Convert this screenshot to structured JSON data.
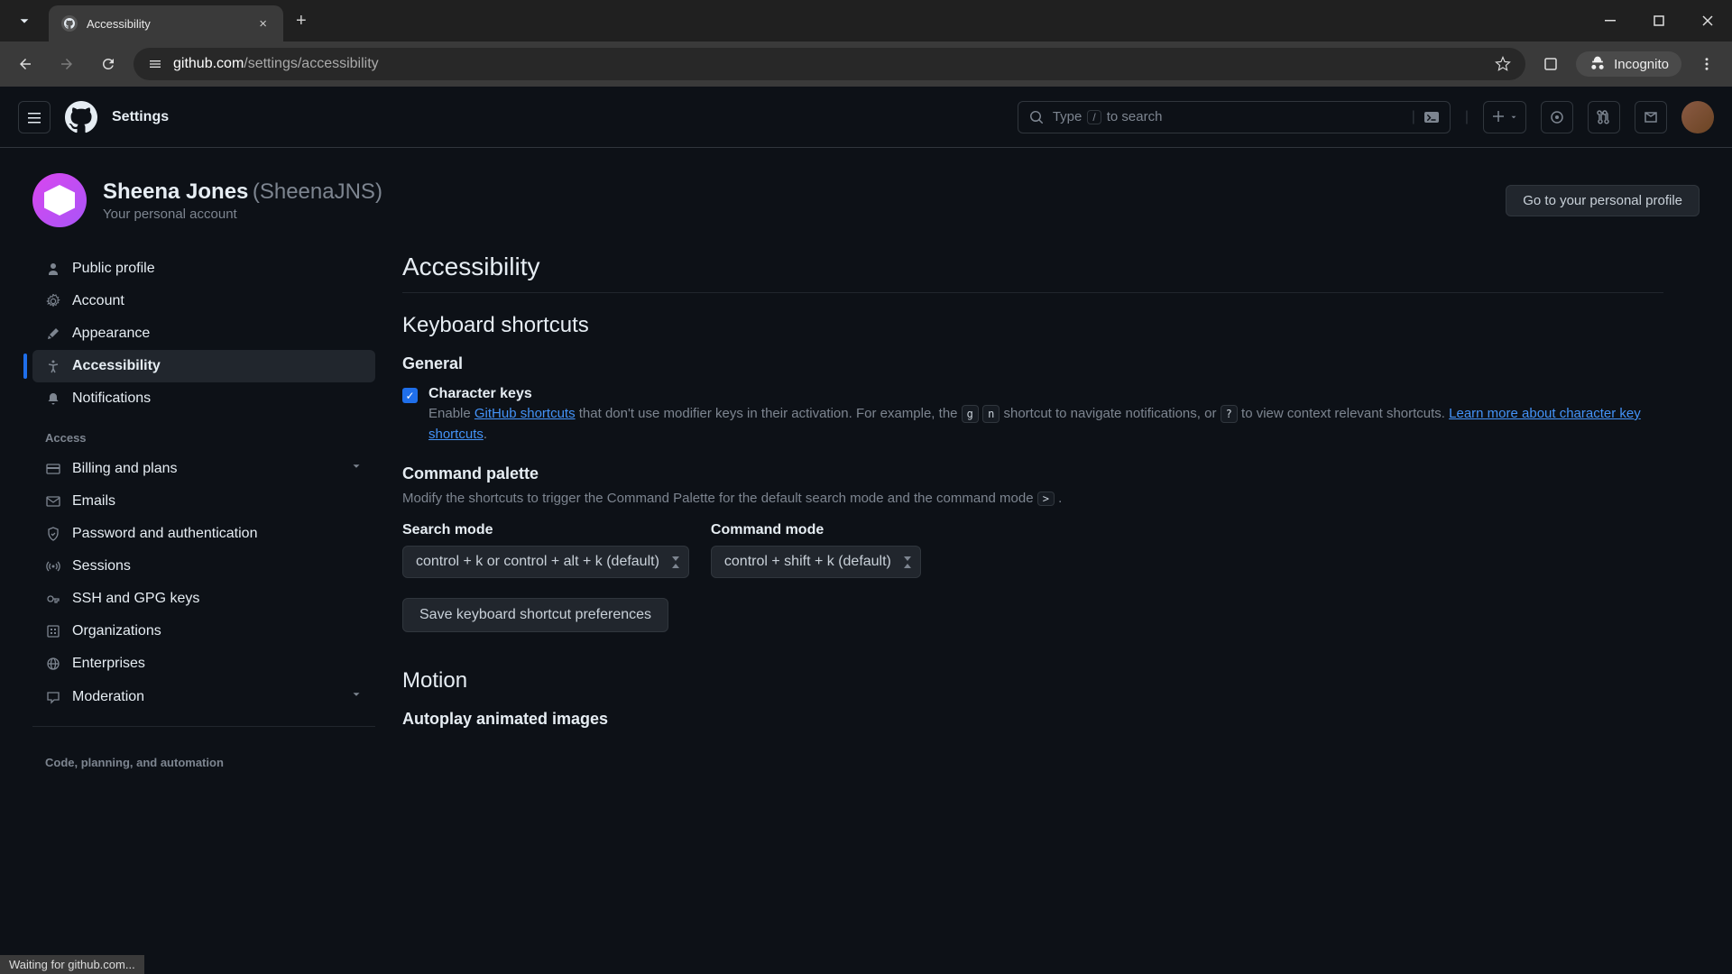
{
  "browser": {
    "tab_title": "Accessibility",
    "url_domain": "github.com",
    "url_path": "/settings/accessibility",
    "incognito_label": "Incognito",
    "status_text": "Waiting for github.com..."
  },
  "header": {
    "title": "Settings",
    "search_prefix": "Type",
    "search_key": "/",
    "search_suffix": "to search"
  },
  "profile": {
    "display_name": "Sheena Jones",
    "handle": "(SheenaJNS)",
    "subtitle": "Your personal account",
    "profile_button": "Go to your personal profile"
  },
  "sidebar": {
    "items_top": [
      {
        "label": "Public profile",
        "icon": "person"
      },
      {
        "label": "Account",
        "icon": "gear"
      },
      {
        "label": "Appearance",
        "icon": "brush"
      },
      {
        "label": "Accessibility",
        "icon": "accessibility",
        "active": true
      },
      {
        "label": "Notifications",
        "icon": "bell"
      }
    ],
    "group_access": "Access",
    "items_access": [
      {
        "label": "Billing and plans",
        "icon": "card",
        "expandable": true
      },
      {
        "label": "Emails",
        "icon": "mail"
      },
      {
        "label": "Password and authentication",
        "icon": "shield"
      },
      {
        "label": "Sessions",
        "icon": "broadcast"
      },
      {
        "label": "SSH and GPG keys",
        "icon": "key"
      },
      {
        "label": "Organizations",
        "icon": "org"
      },
      {
        "label": "Enterprises",
        "icon": "globe"
      },
      {
        "label": "Moderation",
        "icon": "comment",
        "expandable": true
      }
    ],
    "group_code": "Code, planning, and automation"
  },
  "main": {
    "page_title": "Accessibility",
    "keyboard_section": "Keyboard shortcuts",
    "general_heading": "General",
    "char_keys_label": "Character keys",
    "char_keys_desc_1": "Enable ",
    "char_keys_link_1": "GitHub shortcuts",
    "char_keys_desc_2": " that don't use modifier keys in their activation. For example, the ",
    "char_keys_kbd_g": "g",
    "char_keys_kbd_n": "n",
    "char_keys_desc_3": " shortcut to navigate notifications, or ",
    "char_keys_kbd_q": "?",
    "char_keys_desc_4": " to view context relevant shortcuts. ",
    "char_keys_link_2": "Learn more about character key shortcuts",
    "command_palette_heading": "Command palette",
    "command_palette_desc": "Modify the shortcuts to trigger the Command Palette for the default search mode and the command mode",
    "command_palette_kbd": ">",
    "search_mode_label": "Search mode",
    "search_mode_value": "control + k or control + alt + k (default)",
    "command_mode_label": "Command mode",
    "command_mode_value": "control + shift + k (default)",
    "save_button": "Save keyboard shortcut preferences",
    "motion_section": "Motion",
    "autoplay_heading": "Autoplay animated images"
  }
}
